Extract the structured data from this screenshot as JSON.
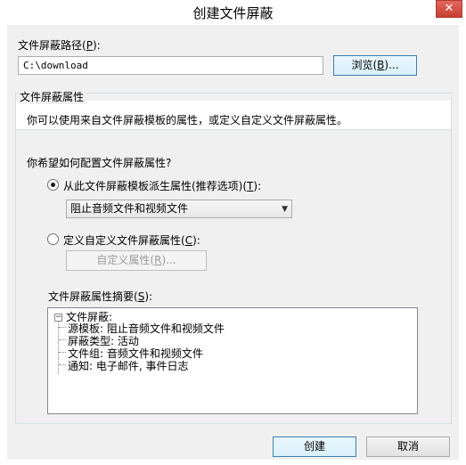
{
  "window": {
    "title": "创建文件屏蔽",
    "close_glyph": "✕"
  },
  "path": {
    "label_prefix": "文件屏蔽路径(",
    "label_key": "P",
    "label_suffix": "):",
    "value": "C:\\download",
    "browse_prefix": "浏览(",
    "browse_key": "B",
    "browse_suffix": ")..."
  },
  "properties": {
    "group_title": "文件屏蔽属性",
    "description": "你可以使用来自文件屏蔽模板的属性，或定义自定义文件屏蔽属性。",
    "question": "你希望如何配置文件屏蔽属性?",
    "option_template": {
      "prefix": "从此文件屏蔽模板派生属性(推荐选项)(",
      "key": "T",
      "suffix": "):",
      "checked": true
    },
    "template_select": {
      "value": "阻止音频文件和视频文件"
    },
    "option_custom": {
      "prefix": "定义自定义文件屏蔽属性(",
      "key": "C",
      "suffix": "):",
      "checked": false
    },
    "custom_button": {
      "prefix": "自定义属性(",
      "key": "R",
      "suffix": ")..."
    },
    "summary_label": {
      "prefix": "文件屏蔽属性摘要(",
      "key": "S",
      "suffix": "):"
    },
    "summary_tree": {
      "root": "文件屏蔽:",
      "expander": "−",
      "children": [
        "源模板: 阻止音频文件和视频文件",
        "屏蔽类型: 活动",
        "文件组: 音频文件和视频文件",
        "通知: 电子邮件, 事件日志"
      ]
    }
  },
  "buttons": {
    "create": "创建",
    "cancel": "取消"
  }
}
